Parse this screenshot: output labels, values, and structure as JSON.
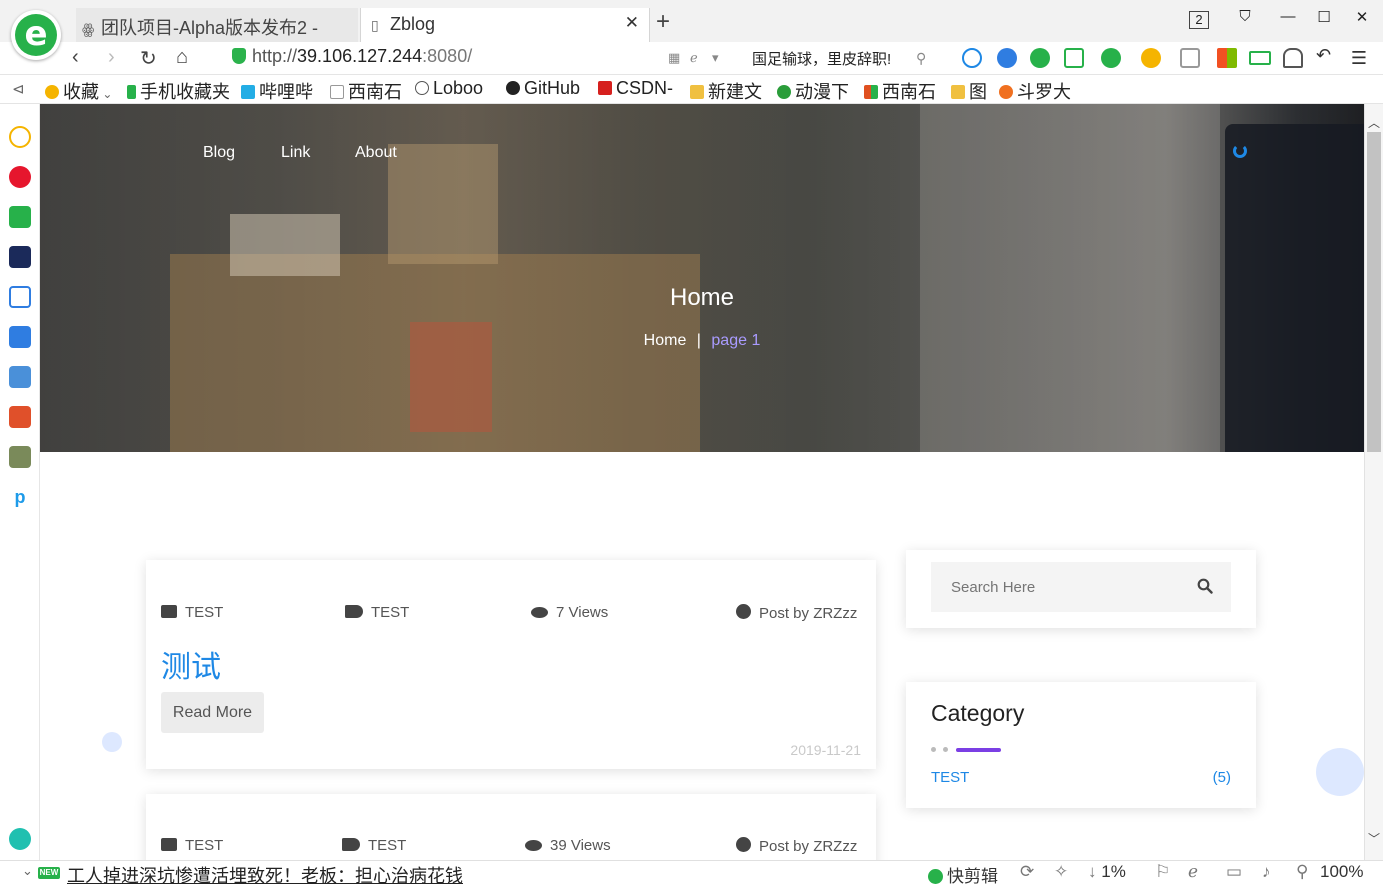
{
  "browser": {
    "tabs": [
      {
        "label": "团队项目-Alpha版本发布2 -",
        "icon": "loboo-icon",
        "active": false
      },
      {
        "label": "Zblog",
        "icon": "page-icon",
        "active": true
      }
    ],
    "new_tab": "+",
    "window_count": "2",
    "url": {
      "proto": "http://",
      "host": "39.106.127.244",
      "port": ":8080/"
    },
    "hot_search": "国足输球，里皮辞职!",
    "bookmarks": [
      {
        "label": "收藏",
        "color": "#f5b400"
      },
      {
        "label": "手机收藏夹",
        "color": "#27b14a"
      },
      {
        "label": "哔哩哔",
        "color": "#23ade5"
      },
      {
        "label": "西南石",
        "color": "#999999"
      },
      {
        "label": "Loboo",
        "color": "#555555"
      },
      {
        "label": "GitHub",
        "color": "#222222"
      },
      {
        "label": "CSDN-",
        "color": "#d6201e"
      },
      {
        "label": "新建文",
        "color": "#f0c040"
      },
      {
        "label": "动漫下",
        "color": "#2a9d3a"
      },
      {
        "label": "西南石",
        "color": "#e05020"
      },
      {
        "label": "图",
        "color": "#f0c040"
      },
      {
        "label": "斗罗大",
        "color": "#f07020"
      }
    ]
  },
  "site": {
    "nav": [
      "Blog",
      "Link",
      "About"
    ],
    "hero_title": "Home",
    "breadcrumb": {
      "home": "Home",
      "sep": "|",
      "current": "page 1"
    }
  },
  "posts": [
    {
      "category": "TEST",
      "tag": "TEST",
      "views": "7 Views",
      "author": "Post by ZRZzz",
      "title": "测试",
      "read_more": "Read More",
      "date": "2019-11-21"
    },
    {
      "category": "TEST",
      "tag": "TEST",
      "views": "39 Views",
      "author": "Post by ZRZzz"
    }
  ],
  "sidebar": {
    "search_placeholder": "Search Here",
    "category_title": "Category",
    "categories": [
      {
        "name": "TEST",
        "count": "(5)"
      }
    ]
  },
  "statusbar": {
    "badge": "NEW",
    "news": "工人掉进深坑惨遭活埋致死！老板：担心治病花钱",
    "clip": "快剪辑",
    "download": "1%",
    "zoom": "100%"
  }
}
